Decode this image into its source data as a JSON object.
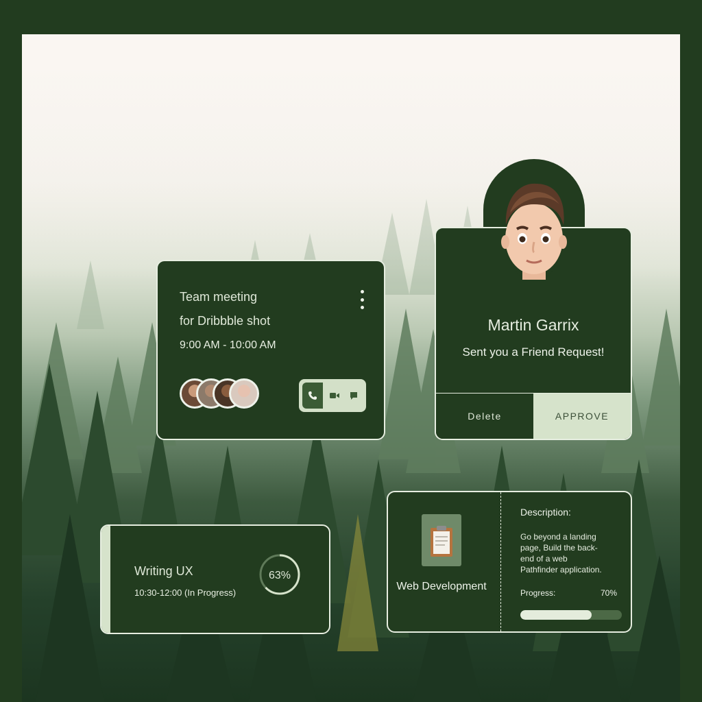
{
  "meeting": {
    "title_line1": "Team meeting",
    "title_line2": "for Dribbble shot",
    "time": "9:00 AM - 10:00 AM",
    "participants": [
      "participant-1",
      "participant-2",
      "participant-3",
      "participant-4"
    ],
    "actions": [
      "phone-icon",
      "video-icon",
      "chat-icon"
    ]
  },
  "friend": {
    "name": "Martin Garrix",
    "message": "Sent you a Friend Request!",
    "delete_label": "Delete",
    "approve_label": "APPROVE"
  },
  "writing": {
    "title": "Writing UX",
    "subtitle": "10:30-12:00 (In Progress)",
    "progress_label": "63%",
    "progress": 0.63
  },
  "webdev": {
    "category": "Web Development",
    "description_label": "Description:",
    "description": "Go beyond a landing page, Build the back-end of a web Pathfinder application.",
    "progress_label": "Progress:",
    "progress_value": "70%",
    "progress": 0.7
  },
  "colors": {
    "dark_green": "#223c1f",
    "pale_green": "#d6e3cb"
  }
}
